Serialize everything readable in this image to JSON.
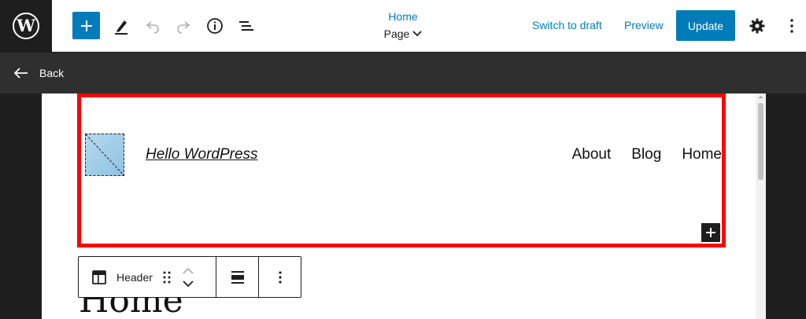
{
  "header": {
    "document_title": "Home",
    "document_type": "Page",
    "switch_to_draft_label": "Switch to draft",
    "preview_label": "Preview",
    "update_label": "Update"
  },
  "backbar": {
    "back_label": "Back"
  },
  "canvas": {
    "site_title": "Hello WordPress",
    "nav_items": [
      "About",
      "Blog",
      "Home"
    ],
    "page_heading": "Home"
  },
  "block_toolbar": {
    "block_name": "Header"
  },
  "colors": {
    "accent": "#007cba",
    "selection": "#ff0000",
    "dark": "#1e1e1e"
  }
}
